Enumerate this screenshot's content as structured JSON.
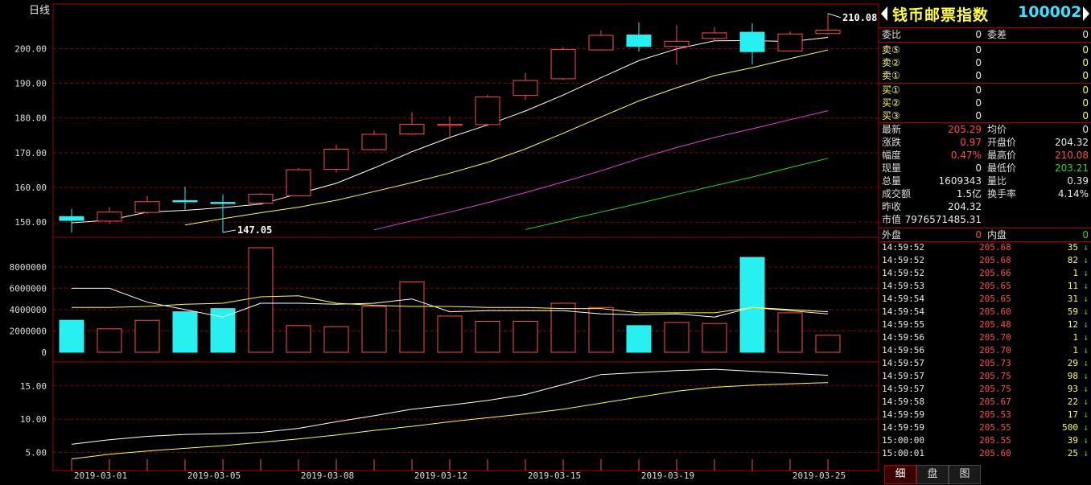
{
  "chart": {
    "period_label": "日线",
    "max_label": "210.08",
    "min_label": "147.05",
    "price_ticks": [
      "200.00",
      "190.00",
      "180.00",
      "170.00",
      "160.00",
      "150.00"
    ],
    "volume_ticks": [
      "8000000",
      "6000000",
      "4000000",
      "2000000",
      "0"
    ],
    "ind_ticks": [
      "15.00",
      "10.00",
      "5.00"
    ],
    "date_labels": [
      "2019-03-01",
      "2019-03-05",
      "2019-03-08",
      "2019-03-12",
      "2019-03-15",
      "2019-03-19",
      "2019-03-25"
    ]
  },
  "chart_data": {
    "type": "candlestick",
    "price_range": [
      147.5,
      210.5
    ],
    "volume_range": [
      0,
      9800000
    ],
    "indicator_range": [
      2.5,
      18
    ],
    "candles": [
      {
        "o": 150.5,
        "c": 151.6,
        "h": 153.8,
        "l": 147.0,
        "up": false
      },
      {
        "o": 150.3,
        "c": 152.9,
        "h": 154.3,
        "l": 149.6,
        "up": true
      },
      {
        "o": 152.8,
        "c": 155.9,
        "h": 157.6,
        "l": 152.3,
        "up": true
      },
      {
        "o": 156.1,
        "c": 156.2,
        "h": 160.2,
        "l": 153.6,
        "up": false
      },
      {
        "o": 155.7,
        "c": 155.4,
        "h": 157.9,
        "l": 147.05,
        "up": false
      },
      {
        "o": 155.5,
        "c": 158.0,
        "h": 158.5,
        "l": 155.3,
        "up": true
      },
      {
        "o": 157.6,
        "c": 165.1,
        "h": 165.6,
        "l": 157.4,
        "up": true
      },
      {
        "o": 165.2,
        "c": 171.0,
        "h": 172.3,
        "l": 164.3,
        "up": true
      },
      {
        "o": 170.9,
        "c": 175.3,
        "h": 176.4,
        "l": 170.6,
        "up": true
      },
      {
        "o": 175.4,
        "c": 178.2,
        "h": 181.7,
        "l": 175.0,
        "up": true
      },
      {
        "o": 177.9,
        "c": 178.2,
        "h": 180.4,
        "l": 174.0,
        "up": true
      },
      {
        "o": 178.1,
        "c": 186.1,
        "h": 186.6,
        "l": 177.6,
        "up": true
      },
      {
        "o": 186.5,
        "c": 190.8,
        "h": 193.0,
        "l": 185.1,
        "up": true
      },
      {
        "o": 191.3,
        "c": 199.7,
        "h": 200.3,
        "l": 191.0,
        "up": true
      },
      {
        "o": 199.6,
        "c": 203.8,
        "h": 205.2,
        "l": 199.4,
        "up": true
      },
      {
        "o": 203.9,
        "c": 200.6,
        "h": 207.5,
        "l": 199.1,
        "up": false
      },
      {
        "o": 200.6,
        "c": 202.1,
        "h": 206.8,
        "l": 195.3,
        "up": true
      },
      {
        "o": 202.9,
        "c": 204.5,
        "h": 206.2,
        "l": 202.1,
        "up": true
      },
      {
        "o": 204.7,
        "c": 199.1,
        "h": 207.3,
        "l": 195.4,
        "up": false
      },
      {
        "o": 199.3,
        "c": 204.2,
        "h": 204.9,
        "l": 199.1,
        "up": true
      },
      {
        "o": 204.3,
        "c": 205.3,
        "h": 210.08,
        "l": 204.1,
        "up": true
      }
    ],
    "ma1": [
      149.8,
      150.6,
      152.9,
      153.4,
      154.2,
      155.2,
      158.2,
      161.2,
      165.6,
      170.3,
      174.4,
      178.0,
      182.0,
      186.6,
      191.6,
      196.5,
      199.9,
      202.2,
      202.3,
      202.0,
      203.2
    ],
    "ma2": [
      null,
      null,
      null,
      149.2,
      151.0,
      152.7,
      154.3,
      156.3,
      158.8,
      161.4,
      164.1,
      167.2,
      171.1,
      175.6,
      180.3,
      184.9,
      188.7,
      192.2,
      194.5,
      197.1,
      199.6
    ],
    "ma3": [
      null,
      null,
      null,
      null,
      null,
      null,
      null,
      null,
      147.8,
      150.4,
      152.9,
      155.6,
      158.5,
      161.6,
      164.8,
      168.3,
      171.5,
      174.4,
      176.9,
      179.5,
      182.1
    ],
    "ma4": [
      null,
      null,
      null,
      null,
      null,
      null,
      null,
      null,
      null,
      null,
      null,
      null,
      147.9,
      150.4,
      152.9,
      155.4,
      158.0,
      160.5,
      163.0,
      165.7,
      168.4
    ],
    "volume": [
      3000000,
      2200000,
      3000000,
      3800000,
      4100000,
      9800000,
      2500000,
      2400000,
      4300000,
      6600000,
      3400000,
      2900000,
      2900000,
      4600000,
      4200000,
      2500000,
      2800000,
      2700000,
      8900000,
      3700000,
      1600000
    ],
    "volume_up": [
      false,
      true,
      true,
      false,
      false,
      true,
      true,
      true,
      true,
      true,
      true,
      true,
      true,
      true,
      true,
      false,
      true,
      true,
      false,
      true,
      true
    ],
    "vma1": [
      6000000,
      6000000,
      4700000,
      4000000,
      3300000,
      4600000,
      4600000,
      4500000,
      4600000,
      5000000,
      3800000,
      3900000,
      3900000,
      3900000,
      3600000,
      3500000,
      3600000,
      3300000,
      4200000,
      4000000,
      3800000
    ],
    "vma2": [
      4200000,
      4200000,
      4300000,
      4500000,
      4600000,
      5200000,
      5300000,
      4600000,
      4400000,
      4300000,
      4300000,
      4200000,
      4200000,
      4100000,
      4100000,
      3700000,
      3700000,
      3700000,
      4200000,
      3900000,
      3600000
    ],
    "ind1": [
      6.2,
      6.9,
      7.4,
      7.7,
      7.8,
      8.0,
      8.6,
      9.6,
      10.5,
      11.5,
      12.1,
      12.8,
      13.7,
      15.2,
      16.7,
      17.0,
      17.3,
      17.5,
      17.2,
      16.9,
      16.6
    ],
    "ind2": [
      4.0,
      4.7,
      5.2,
      5.6,
      6.0,
      6.5,
      7.0,
      7.6,
      8.3,
      8.9,
      9.6,
      10.2,
      10.8,
      11.5,
      12.4,
      13.3,
      14.2,
      14.8,
      15.1,
      15.3,
      15.5
    ]
  },
  "panel": {
    "stock_name": "钱币邮票指数",
    "stock_code": "100002",
    "wei_bi_label": "委比",
    "wei_bi_value": "0",
    "wei_cha_label": "委差",
    "wei_cha_value": "0",
    "sell_levels": [
      {
        "label": "卖⑤",
        "price": "0",
        "qty": "0"
      },
      {
        "label": "卖②",
        "price": "0",
        "qty": "0"
      },
      {
        "label": "卖①",
        "price": "0",
        "qty": "0"
      }
    ],
    "buy_levels": [
      {
        "label": "买①",
        "price": "0",
        "qty": "0"
      },
      {
        "label": "买②",
        "price": "0",
        "qty": "0"
      },
      {
        "label": "买③",
        "price": "0",
        "qty": "0"
      }
    ],
    "quote_rows": [
      {
        "l1": "最新",
        "v1": "205.29",
        "c1": "red",
        "l2": "均价",
        "v2": "0",
        "c2": "white"
      },
      {
        "l1": "涨跌",
        "v1": "0.97",
        "c1": "red",
        "l2": "开盘价",
        "v2": "204.32",
        "c2": "white"
      },
      {
        "l1": "幅度",
        "v1": "0.47%",
        "c1": "red",
        "l2": "最高价",
        "v2": "210.08",
        "c2": "red"
      },
      {
        "l1": "现量",
        "v1": "0",
        "c1": "white",
        "l2": "最低价",
        "v2": "203.21",
        "c2": "green"
      },
      {
        "l1": "总量",
        "v1": "1609343",
        "c1": "white",
        "l2": "量比",
        "v2": "0.39",
        "c2": "white"
      },
      {
        "l1": "成交额",
        "v1": "1.5亿",
        "c1": "white",
        "l2": "换手率",
        "v2": "4.14%",
        "c2": "white"
      },
      {
        "l1": "昨收",
        "v1": "204.32",
        "c1": "white",
        "l2": "",
        "v2": "",
        "c2": "white"
      },
      {
        "l1": "市值",
        "v1": "7976571485.31",
        "c1": "white",
        "l2": "",
        "v2": "",
        "c2": "white"
      }
    ],
    "outer_label": "外盘",
    "outer_value": "0",
    "inner_label": "内盘",
    "inner_value": "0",
    "ticks": [
      {
        "time": "14:59:52",
        "price": "205.68",
        "vol": "35"
      },
      {
        "time": "14:59:52",
        "price": "205.68",
        "vol": "82"
      },
      {
        "time": "14:59:52",
        "price": "205.66",
        "vol": "1"
      },
      {
        "time": "14:59:53",
        "price": "205.65",
        "vol": "11"
      },
      {
        "time": "14:59:54",
        "price": "205.65",
        "vol": "31"
      },
      {
        "time": "14:59:54",
        "price": "205.60",
        "vol": "59"
      },
      {
        "time": "14:59:55",
        "price": "205.48",
        "vol": "12"
      },
      {
        "time": "14:59:56",
        "price": "205.70",
        "vol": "1"
      },
      {
        "time": "14:59:56",
        "price": "205.70",
        "vol": "1"
      },
      {
        "time": "14:59:57",
        "price": "205.73",
        "vol": "29"
      },
      {
        "time": "14:59:57",
        "price": "205.75",
        "vol": "98"
      },
      {
        "time": "14:59:57",
        "price": "205.75",
        "vol": "93"
      },
      {
        "time": "14:59:58",
        "price": "205.67",
        "vol": "22"
      },
      {
        "time": "14:59:59",
        "price": "205.53",
        "vol": "17"
      },
      {
        "time": "14:59:59",
        "price": "205.55",
        "vol": "500"
      },
      {
        "time": "15:00:00",
        "price": "205.55",
        "vol": "39"
      },
      {
        "time": "15:00:01",
        "price": "205.60",
        "vol": "25"
      }
    ],
    "tick_arrow": "↓",
    "tabs": [
      "细",
      "盘",
      "图"
    ]
  }
}
